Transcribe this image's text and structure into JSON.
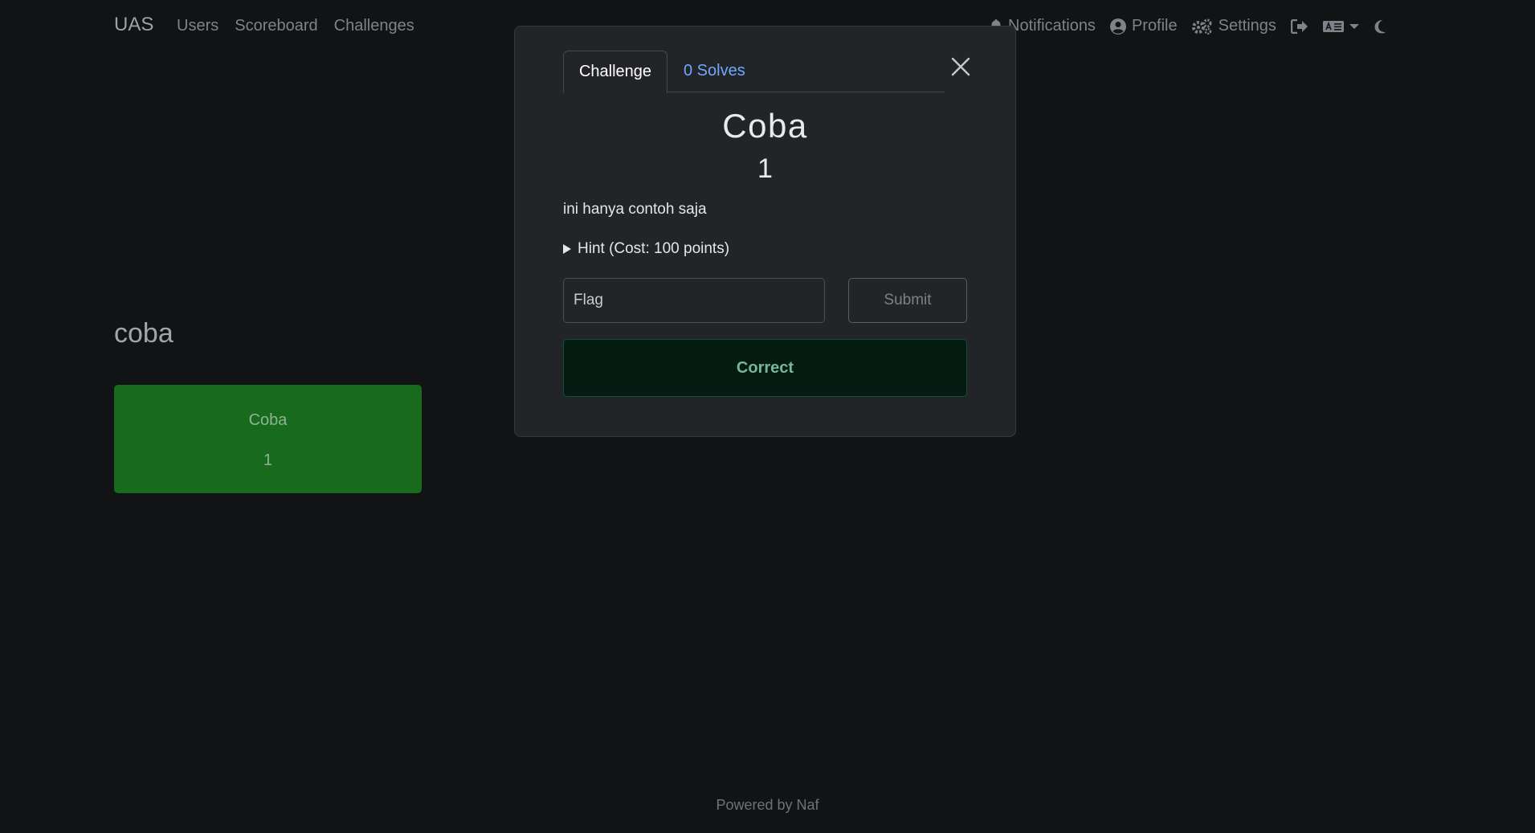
{
  "navbar": {
    "brand": "UAS",
    "left_links": [
      {
        "label": "Users"
      },
      {
        "label": "Scoreboard"
      },
      {
        "label": "Challenges"
      }
    ],
    "right_items": {
      "notifications": {
        "label": "Notifications",
        "icon": "bell-icon"
      },
      "profile": {
        "label": "Profile",
        "icon": "user-circle-icon"
      },
      "settings": {
        "label": "Settings",
        "icon": "cogs-icon"
      },
      "logout": {
        "icon": "sign-out-icon"
      },
      "language": {
        "icon": "language-icon"
      },
      "theme": {
        "icon": "moon-icon"
      }
    }
  },
  "category": {
    "title": "coba",
    "challenges": [
      {
        "name": "Coba",
        "value": "1",
        "color": "#186a1d"
      }
    ]
  },
  "modal": {
    "tabs": [
      {
        "label": "Challenge",
        "active": true
      },
      {
        "label": "0 Solves",
        "active": false
      }
    ],
    "title": "Coba",
    "value": "1",
    "description": "ini hanya contoh saja",
    "hint_label": "Hint (Cost: 100 points)",
    "flag_input": {
      "value": "",
      "placeholder": "Flag"
    },
    "submit_label": "Submit",
    "result": {
      "message": "Correct",
      "status_color": "#75b798"
    }
  },
  "footer": {
    "text": "Powered by Naf"
  },
  "colors": {
    "background": "#121315",
    "modal_bg": "#222427",
    "link_accent": "#6ea8fe",
    "solved_card": "#186a1d",
    "success_text": "#75b798"
  }
}
